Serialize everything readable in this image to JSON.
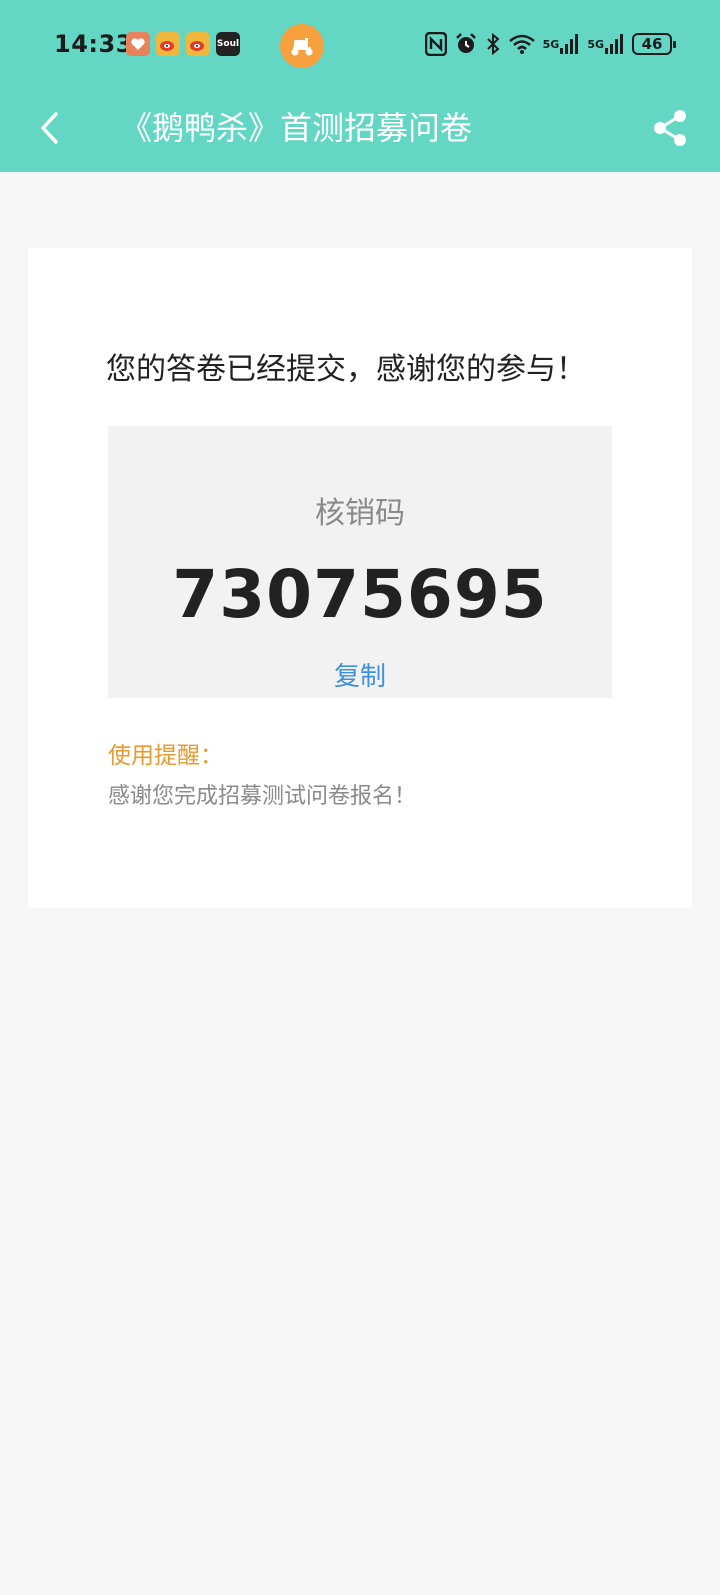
{
  "status_bar": {
    "time": "14:33",
    "notifications": [
      {
        "name": "health-app-icon",
        "color": "#e8825a"
      },
      {
        "name": "weibo-icon",
        "color": "#f0b73d"
      },
      {
        "name": "weibo-icon",
        "color": "#f0b73d"
      },
      {
        "name": "soul-app-icon",
        "color": "#222222",
        "label": "Soul"
      }
    ],
    "delivery_badge_color": "#f6a13d",
    "signal_1": "5G",
    "signal_2": "5G",
    "battery": "46"
  },
  "header": {
    "background": "#63d6c4",
    "title": "《鹅鸭杀》首测招募问卷",
    "back_icon": "chevron-left-icon",
    "share_icon": "share-icon"
  },
  "card": {
    "message": "您的答卷已经提交，感谢您的参与！",
    "code_box": {
      "label": "核销码",
      "value": "73075695",
      "copy_label": "复制"
    },
    "tip": {
      "title": "使用提醒：",
      "text": "感谢您完成招募测试问卷报名！"
    }
  }
}
